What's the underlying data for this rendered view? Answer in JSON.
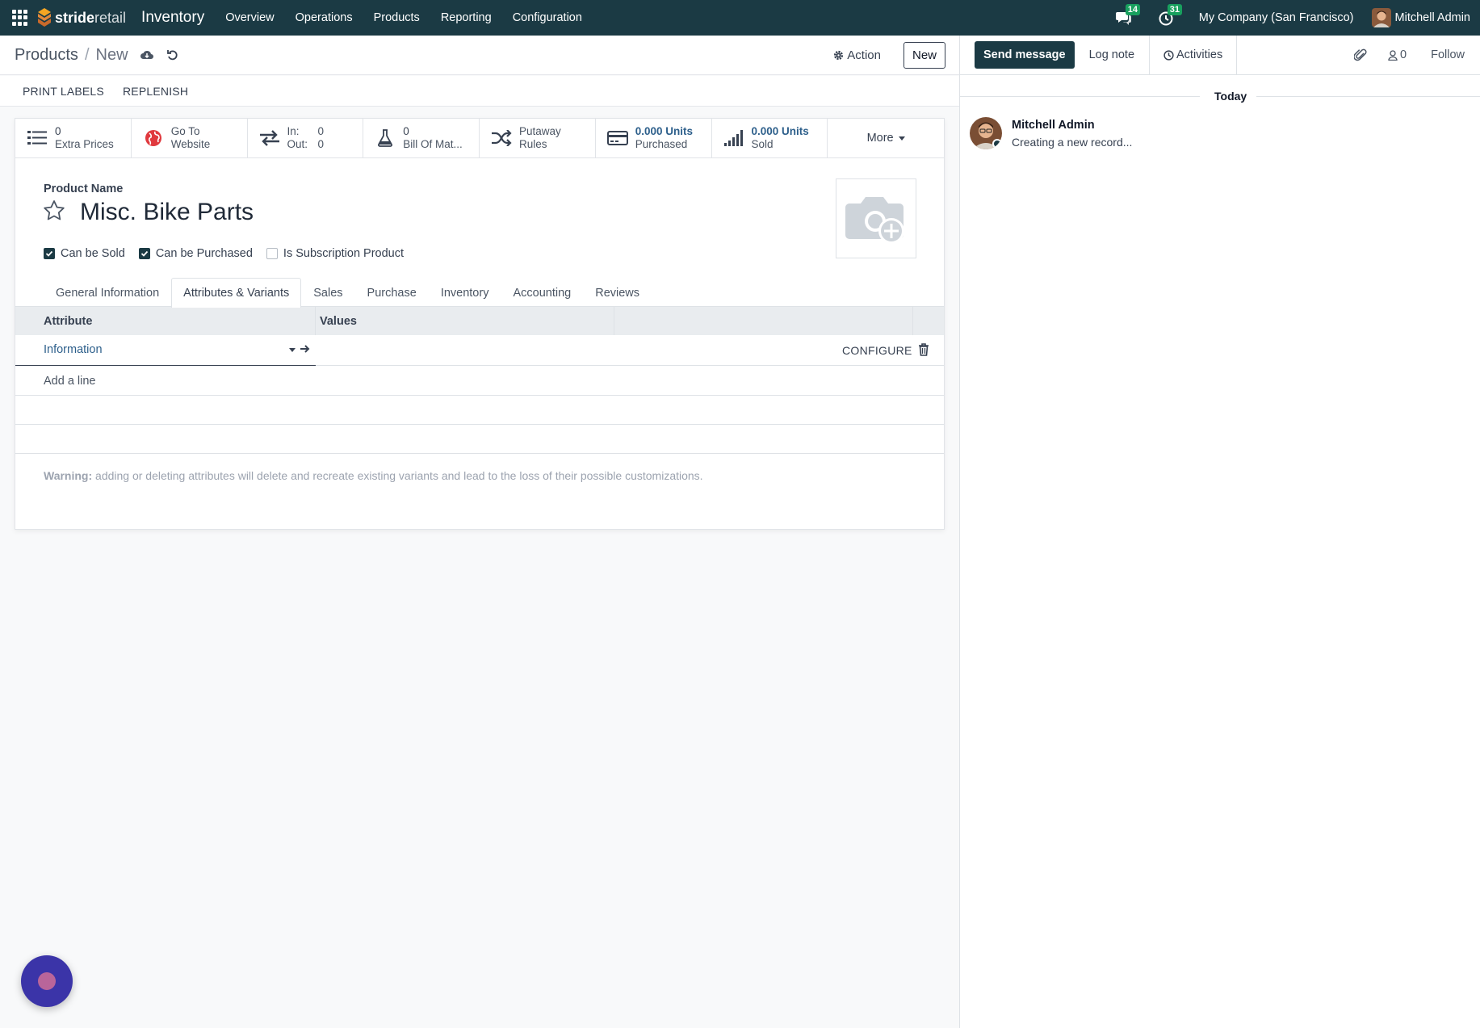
{
  "topbar": {
    "brand_bold": "stride",
    "brand_light": "retail",
    "app_name": "Inventory",
    "menu": [
      "Overview",
      "Operations",
      "Products",
      "Reporting",
      "Configuration"
    ],
    "messages_count": "14",
    "activities_count": "31",
    "company": "My Company (San Francisco)",
    "user": "Mitchell Admin"
  },
  "control": {
    "breadcrumb_parent": "Products",
    "breadcrumb_current": "New",
    "action_label": "Action",
    "new_label": "New"
  },
  "statusbar": {
    "buttons": [
      "PRINT LABELS",
      "REPLENISH"
    ]
  },
  "smart_buttons": {
    "extra_prices": {
      "value": "0",
      "label": "Extra Prices"
    },
    "website": {
      "line1": "Go To",
      "line2": "Website"
    },
    "in_out": {
      "in_label": "In:",
      "in_value": "0",
      "out_label": "Out:",
      "out_value": "0"
    },
    "bom": {
      "value": "0",
      "label": "Bill Of Mat..."
    },
    "putaway": {
      "line1": "Putaway",
      "line2": "Rules"
    },
    "purchased": {
      "value": "0.000 Units",
      "label": "Purchased"
    },
    "sold": {
      "value": "0.000 Units",
      "label": "Sold"
    },
    "more": "More"
  },
  "form": {
    "product_name_label": "Product Name",
    "product_name": "Misc. Bike Parts",
    "checkboxes": [
      {
        "label": "Can be Sold",
        "checked": true
      },
      {
        "label": "Can be Purchased",
        "checked": true
      },
      {
        "label": "Is Subscription Product",
        "checked": false
      }
    ],
    "tabs": [
      "General Information",
      "Attributes & Variants",
      "Sales",
      "Purchase",
      "Inventory",
      "Accounting",
      "Reviews"
    ],
    "active_tab": "Attributes & Variants"
  },
  "attributes": {
    "col_attribute": "Attribute",
    "col_values": "Values",
    "row_attribute": "Information",
    "configure": "CONFIGURE",
    "add_line": "Add a line",
    "warning_bold": "Warning:",
    "warning_text": " adding or deleting attributes will delete and recreate existing variants and lead to the loss of their possible customizations."
  },
  "chatter": {
    "send_message": "Send message",
    "log_note": "Log note",
    "activities": "Activities",
    "followers_count": "0",
    "follow": "Follow",
    "date_label": "Today",
    "messages": [
      {
        "author": "Mitchell Admin",
        "text": "Creating a new record..."
      }
    ]
  },
  "colors": {
    "navbar": "#1b3a44",
    "badge": "#18a05e",
    "link": "#2d5f8b"
  }
}
